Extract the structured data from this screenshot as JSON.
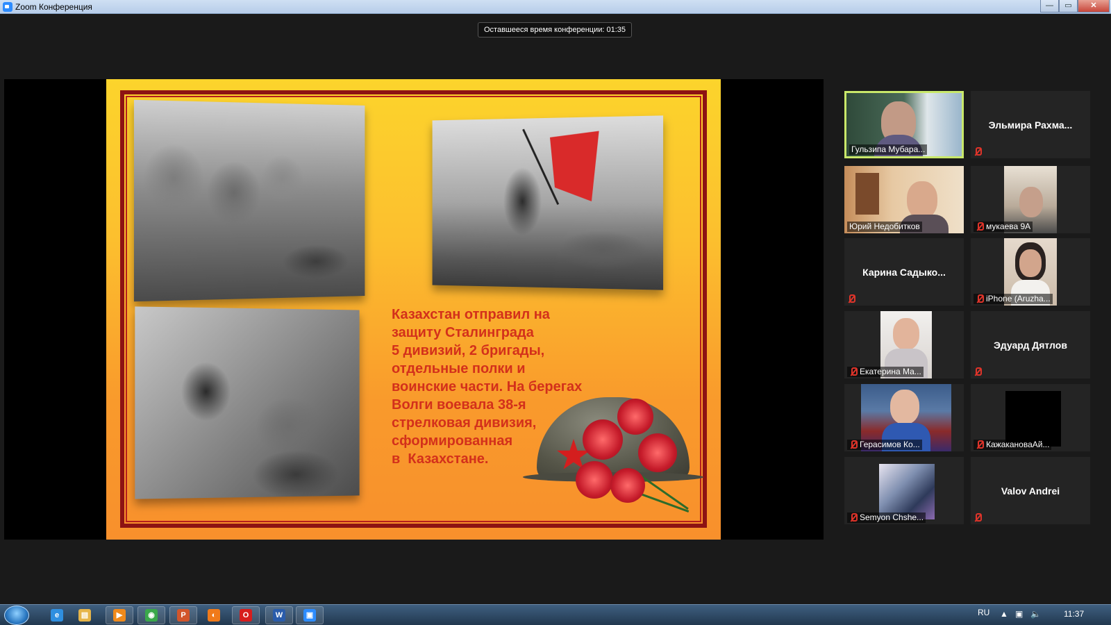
{
  "window": {
    "title": "Zoom Конференция",
    "buttons": {
      "minimize": "—",
      "maximize": "▭",
      "close": "✕"
    }
  },
  "meeting": {
    "remaining_time": "Оставшееся время конференции: 01:35"
  },
  "slide": {
    "text": "Казахстан отправил на\nзащиту Сталинграда\n5 дивизий, 2 бригады,\nотдельные полки и\nвоинские части. На берегах\nВолги воевала 38-я\nстрелковая дивизия,\nсформированная\nв  Казахстане."
  },
  "participants": [
    {
      "name": "Гульзипа Мубара...",
      "video": true,
      "active": true,
      "muted": true
    },
    {
      "name": "Эльмира  Рахма...",
      "video": false,
      "active": false,
      "muted": true
    },
    {
      "name": "Юрий Недобитков",
      "video": true,
      "active": false,
      "muted": false
    },
    {
      "name": "мукаева 9А",
      "video": true,
      "active": false,
      "muted": true
    },
    {
      "name": "Карина  Садыко...",
      "video": false,
      "active": false,
      "muted": true
    },
    {
      "name": "iPhone (Aruzha...",
      "video": true,
      "active": false,
      "muted": true
    },
    {
      "name": "Екатерина Ма...",
      "video": true,
      "active": false,
      "muted": true
    },
    {
      "name": "Эдуард Дятлов",
      "video": false,
      "active": false,
      "muted": true
    },
    {
      "name": "Герасимов Ко...",
      "video": true,
      "active": false,
      "muted": true
    },
    {
      "name": "КажакановаАй...",
      "video": true,
      "active": false,
      "muted": true
    },
    {
      "name": "Semyon Chshe...",
      "video": true,
      "active": false,
      "muted": true
    },
    {
      "name": "Valov Andrei",
      "video": false,
      "active": false,
      "muted": true
    }
  ],
  "taskbar": {
    "items": [
      {
        "icon": "internet-explorer-icon",
        "glyph": "e",
        "color": "#2f8fe0"
      },
      {
        "icon": "file-explorer-icon",
        "glyph": "▤",
        "color": "#e6b54a"
      },
      {
        "icon": "media-player-icon",
        "glyph": "▶",
        "color": "#f08a1c"
      },
      {
        "icon": "chrome-icon",
        "glyph": "◉",
        "color": "#3aa84b"
      },
      {
        "icon": "powerpoint-icon",
        "glyph": "P",
        "color": "#d2552b"
      },
      {
        "icon": "firefox-icon",
        "glyph": "◐",
        "color": "#f07a1a"
      },
      {
        "icon": "opera-icon",
        "glyph": "O",
        "color": "#d71d1d"
      },
      {
        "icon": "word-icon",
        "glyph": "W",
        "color": "#2a5cab"
      },
      {
        "icon": "zoom-icon",
        "glyph": "▣",
        "color": "#2d8cff"
      }
    ],
    "language": "RU",
    "clock": "11:37"
  }
}
